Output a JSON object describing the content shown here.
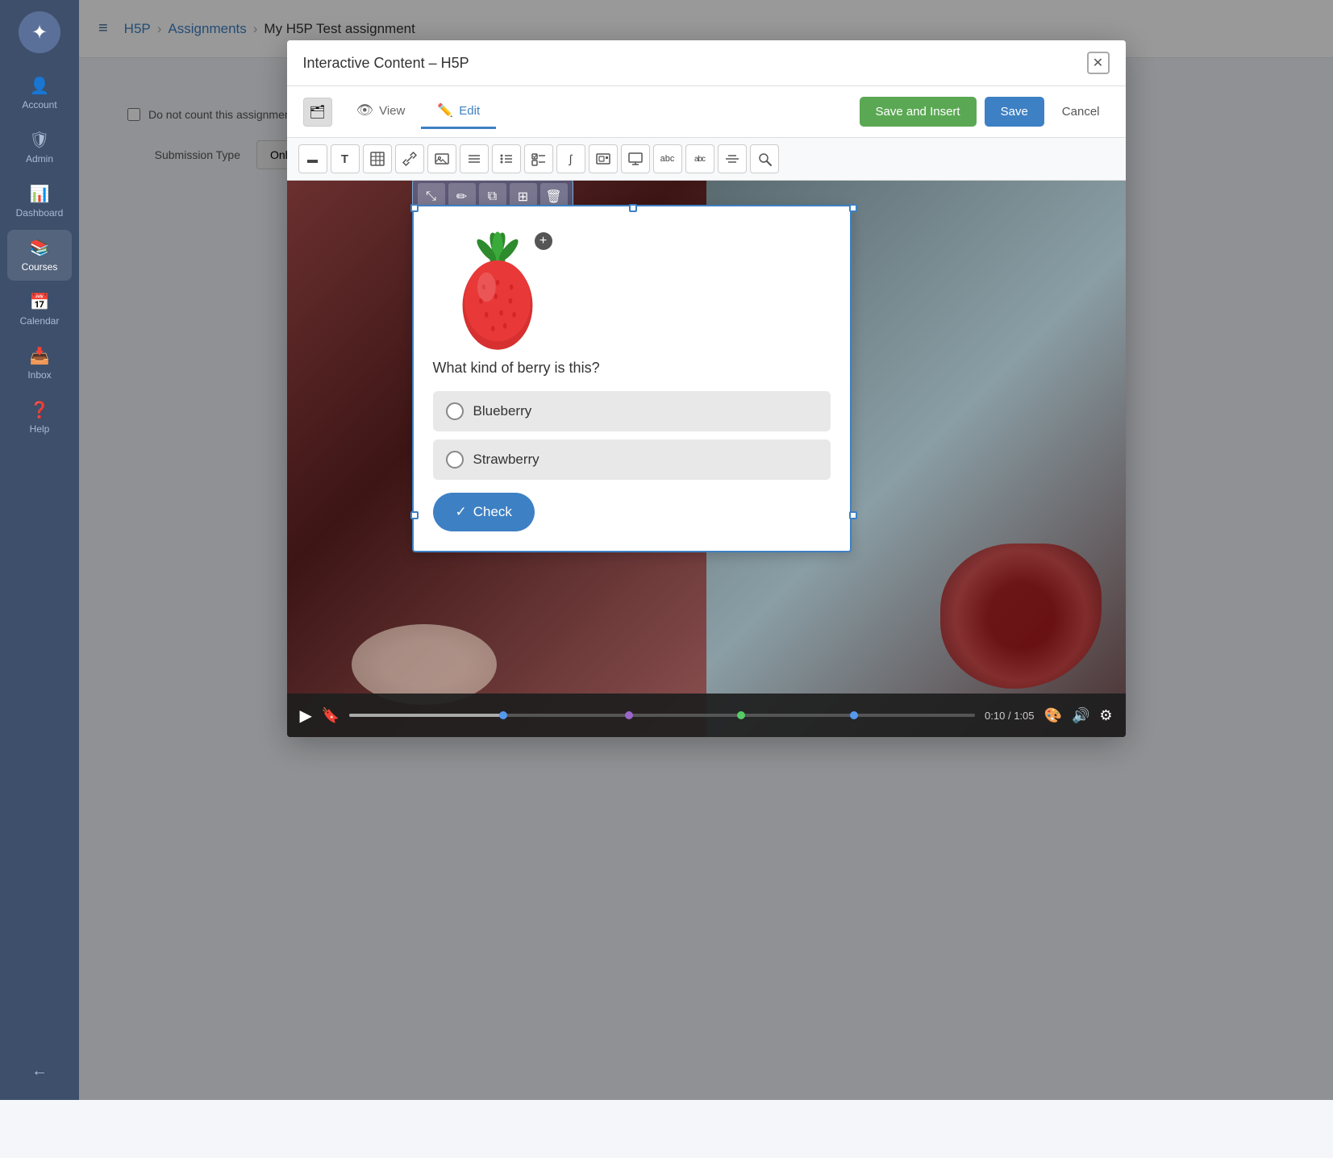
{
  "sidebar": {
    "logo_icon": "☁",
    "items": [
      {
        "id": "account",
        "label": "Account",
        "icon": "👤",
        "active": false
      },
      {
        "id": "admin",
        "label": "Admin",
        "icon": "🛡",
        "active": false
      },
      {
        "id": "dashboard",
        "label": "Dashboard",
        "icon": "📊",
        "active": false
      },
      {
        "id": "courses",
        "label": "Courses",
        "icon": "📚",
        "active": true
      },
      {
        "id": "calendar",
        "label": "Calendar",
        "icon": "📅",
        "active": false
      },
      {
        "id": "inbox",
        "label": "Inbox",
        "icon": "📥",
        "active": false
      },
      {
        "id": "help",
        "label": "Help",
        "icon": "❓",
        "active": false
      }
    ],
    "collapse_icon": "←"
  },
  "topbar": {
    "hamburger": "≡",
    "breadcrumbs": [
      {
        "label": "H5P",
        "link": true
      },
      {
        "label": "Assignments",
        "link": true
      },
      {
        "label": "My H5P Test assignment",
        "link": false
      }
    ]
  },
  "modal": {
    "title": "Interactive Content – H5P",
    "close_icon": "✕",
    "tabs": [
      {
        "id": "view",
        "label": "View",
        "icon": "👁",
        "active": false
      },
      {
        "id": "edit",
        "label": "Edit",
        "icon": "✏️",
        "active": true
      }
    ],
    "actions": {
      "save_insert": "Save and Insert",
      "save": "Save",
      "cancel": "Cancel"
    },
    "editor_toolbar": [
      {
        "id": "minus",
        "icon": "▬"
      },
      {
        "id": "text",
        "icon": "T"
      },
      {
        "id": "table",
        "icon": "⊞"
      },
      {
        "id": "link",
        "icon": "🔗"
      },
      {
        "id": "image",
        "icon": "🖼"
      },
      {
        "id": "list",
        "icon": "☰"
      },
      {
        "id": "list2",
        "icon": "≡"
      },
      {
        "id": "checklist",
        "icon": "☑"
      },
      {
        "id": "formula",
        "icon": "∫"
      },
      {
        "id": "media",
        "icon": "⬛"
      },
      {
        "id": "screen",
        "icon": "🖥"
      },
      {
        "id": "textbox",
        "icon": "abc"
      },
      {
        "id": "textbox2",
        "icon": "abc"
      },
      {
        "id": "strikethrough",
        "icon": "☰"
      },
      {
        "id": "search",
        "icon": "🔍"
      }
    ],
    "float_toolbar": [
      {
        "id": "resize",
        "icon": "⤡"
      },
      {
        "id": "edit",
        "icon": "✏"
      },
      {
        "id": "copy",
        "icon": "⧉"
      },
      {
        "id": "paste",
        "icon": "📋"
      },
      {
        "id": "delete",
        "icon": "🗑"
      }
    ],
    "content": {
      "question": "What kind of berry is this?",
      "options": [
        {
          "id": "blueberry",
          "label": "Blueberry"
        },
        {
          "id": "strawberry",
          "label": "Strawberry"
        }
      ],
      "check_btn": "Check",
      "check_icon": "✓"
    },
    "video": {
      "play_icon": "▶",
      "bookmark_icon": "🔖",
      "time_current": "0:10",
      "time_total": "1:05",
      "time_separator": " / ",
      "palette_icon": "🎨",
      "volume_icon": "🔊",
      "settings_icon": "⚙"
    }
  },
  "page_form": {
    "checkbox_label": "Do not count this assignment towards the final grade",
    "submission_label": "Submission Type"
  },
  "colors": {
    "accent_blue": "#3d80c4",
    "save_insert_green": "#5ba854",
    "sidebar_bg": "#3d4f6b",
    "active_tab_border": "#3d80c4"
  }
}
